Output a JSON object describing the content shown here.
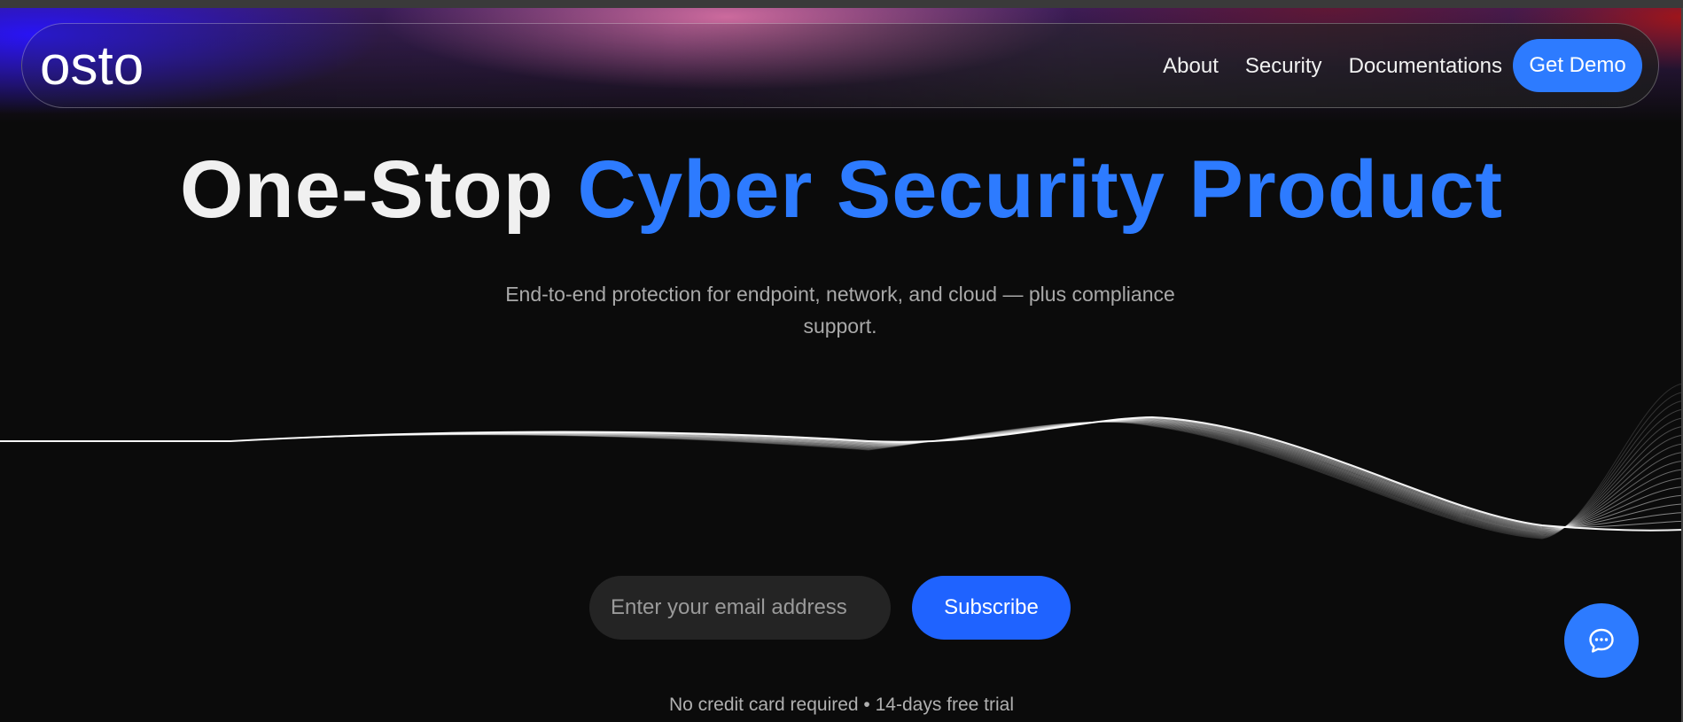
{
  "header": {
    "logo_text": "osto",
    "nav_items": [
      {
        "label": "About"
      },
      {
        "label": "Security"
      },
      {
        "label": "Documentations"
      }
    ],
    "cta_label": "Get Demo"
  },
  "hero": {
    "title_part1": "One-Stop",
    "title_part2": "Cyber Security Product",
    "subtitle": "End-to-end protection for endpoint, network, and cloud — plus compliance support."
  },
  "signup": {
    "email_placeholder": "Enter your email address",
    "email_value": "",
    "subscribe_label": "Subscribe",
    "fine_print": "No credit card required • 14-days free trial"
  },
  "chat": {
    "icon": "chat-bubble-icon"
  },
  "colors": {
    "accent": "#2d7bff",
    "subscribe": "#1f63ff",
    "background": "#0b0b0b"
  }
}
